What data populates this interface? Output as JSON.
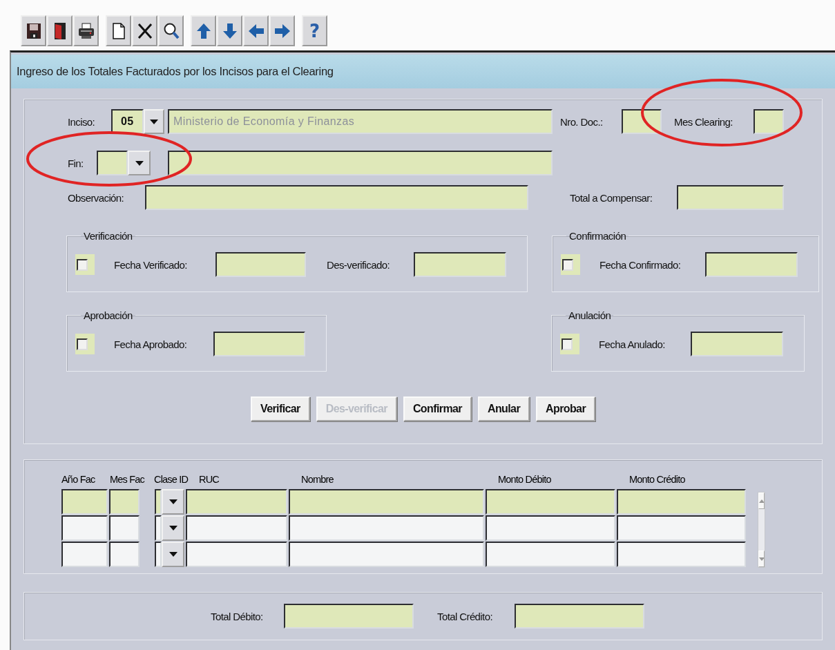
{
  "toolbar": [
    {
      "buttons": [
        {
          "kind": "save"
        },
        {
          "kind": "exit"
        },
        {
          "kind": "print"
        }
      ]
    },
    {
      "buttons": [
        {
          "kind": "new"
        },
        {
          "kind": "delete"
        },
        {
          "kind": "search"
        }
      ]
    },
    {
      "buttons": [
        {
          "kind": "up"
        },
        {
          "kind": "down"
        },
        {
          "kind": "left"
        },
        {
          "kind": "right"
        }
      ]
    },
    {
      "buttons": [
        {
          "kind": "help",
          "glyph": "?"
        }
      ]
    }
  ],
  "window": {
    "title": "Ingreso de los Totales Facturados por los Incisos para el Clearing"
  },
  "header": {
    "inciso": {
      "label": "Inciso:",
      "code": "05",
      "name": "Ministerio de Economía y Finanzas"
    },
    "nro_doc": {
      "label": "Nro. Doc.:"
    },
    "mes_clearing": {
      "label": "Mes Clearing:"
    },
    "fin": {
      "label": "Fin:"
    },
    "observacion": {
      "label": "Observación:"
    },
    "total_compensar": {
      "label": "Total a Compensar:"
    }
  },
  "groups": [
    {
      "title": "Verificación",
      "checked": false,
      "fields": [
        {
          "label": "Fecha Verificado:"
        },
        {
          "label": "Des-verificado:"
        }
      ]
    },
    {
      "title": "Confirmación",
      "checked": false,
      "fields": [
        {
          "label": "Fecha Confirmado:"
        }
      ]
    },
    {
      "title": "Aprobación",
      "checked": false,
      "fields": [
        {
          "label": "Fecha Aprobado:"
        }
      ]
    },
    {
      "title": "Anulación",
      "checked": false,
      "fields": [
        {
          "label": "Fecha Anulado:"
        }
      ]
    }
  ],
  "buttons": [
    {
      "label": "Verificar",
      "disabled": false
    },
    {
      "label": "Des-verificar",
      "disabled": true
    },
    {
      "label": "Confirmar",
      "disabled": false
    },
    {
      "label": "Anular",
      "disabled": false
    },
    {
      "label": "Aprobar",
      "disabled": false
    }
  ],
  "table": {
    "columns": [
      "Año Fac",
      "Mes Fac",
      "Clase ID",
      "RUC",
      "Nombre",
      "Monto Débito",
      "Monto Crédito"
    ],
    "rows": [
      {
        "selected": true
      },
      {
        "selected": false
      },
      {
        "selected": false
      }
    ]
  },
  "totals": [
    {
      "label": "Total Débito:"
    },
    {
      "label": "Total Crédito:"
    }
  ],
  "annotations": [
    {
      "kind": "ellipse",
      "color": "#e02424"
    },
    {
      "kind": "ellipse",
      "color": "#e02424"
    }
  ]
}
